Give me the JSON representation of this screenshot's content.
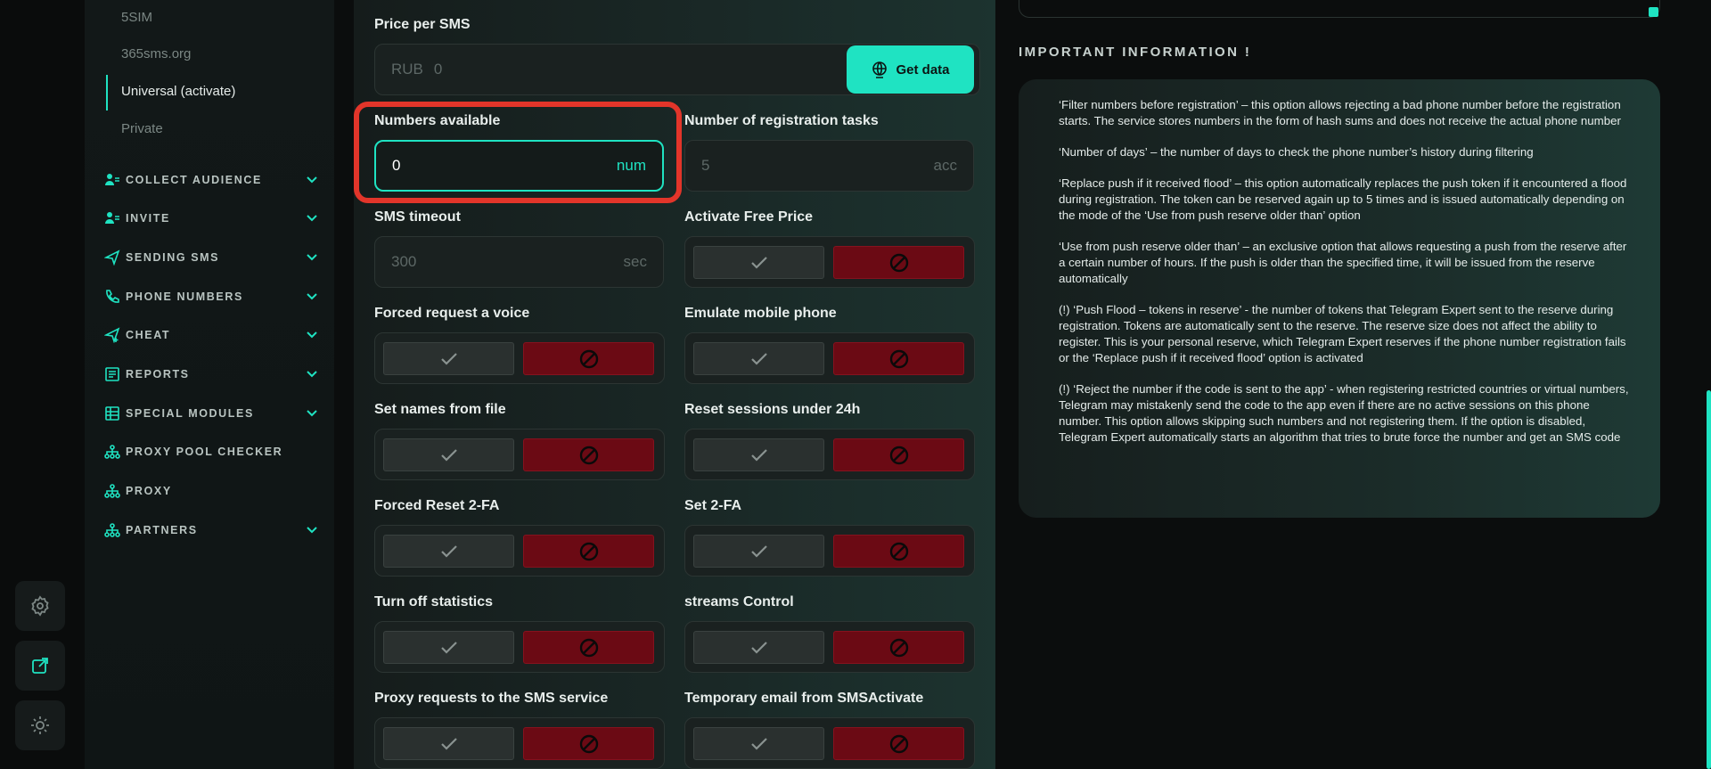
{
  "sidebar": {
    "sub_items": [
      "5SIM",
      "365sms.org",
      "Universal (activate)",
      "Private"
    ],
    "nav": [
      {
        "label": "COLLECT AUDIENCE",
        "icon": "users-icon",
        "chevron": true
      },
      {
        "label": "INVITE",
        "icon": "user-add-icon",
        "chevron": true
      },
      {
        "label": "SENDING SMS",
        "icon": "send-icon",
        "chevron": true
      },
      {
        "label": "PHONE NUMBERS",
        "icon": "phone-icon",
        "chevron": true
      },
      {
        "label": "CHEAT",
        "icon": "send-plus-icon",
        "chevron": true
      },
      {
        "label": "REPORTS",
        "icon": "report-icon",
        "chevron": true
      },
      {
        "label": "SPECIAL MODULES",
        "icon": "table-icon",
        "chevron": true
      },
      {
        "label": "PROXY POOL CHECKER",
        "icon": "network-icon",
        "chevron": false
      },
      {
        "label": "PROXY",
        "icon": "network-icon",
        "chevron": false
      },
      {
        "label": "PARTNERS",
        "icon": "network-icon",
        "chevron": true
      }
    ]
  },
  "rail": {
    "icons": [
      "settings-icon",
      "external-link-icon",
      "theme-icon"
    ]
  },
  "form": {
    "price": {
      "label": "Price per SMS",
      "currency": "RUB",
      "value": "0",
      "button": "Get data"
    },
    "numbers_available": {
      "label": "Numbers available",
      "value": "0",
      "unit": "num"
    },
    "registration_tasks": {
      "label": "Number of registration tasks",
      "value": "5",
      "unit": "acc"
    },
    "sms_timeout": {
      "label": "SMS timeout",
      "value": "300",
      "unit": "sec"
    },
    "toggles": [
      "Activate Free Price",
      "Forced request a voice",
      "Emulate mobile phone",
      "Set names from file",
      "Reset sessions under 24h",
      "Forced Reset 2-FA",
      "Set 2-FA",
      "Turn off statistics",
      "streams Control",
      "Proxy requests to the SMS service",
      "Temporary email from SMSActivate"
    ]
  },
  "info": {
    "title": "IMPORTANT INFORMATION !",
    "paragraphs": [
      "‘Filter numbers before registration’ – this option allows rejecting a bad phone number before the registration starts. The service stores numbers in the form of hash sums and does not receive the actual phone number",
      "‘Number of days’ – the number of days to check the phone number’s history during filtering",
      "‘Replace push if it received flood’ – this option automatically replaces the push token if it encountered a flood during registration. The token can be reserved again up to 5 times and is issued automatically depending on the mode of the ‘Use from push reserve older than’ option",
      "‘Use from push reserve older than’ – an exclusive option that allows requesting a push from the reserve after a certain number of hours. If the push is older than the specified time, it will be issued from the reserve automatically",
      "(!) ‘Push Flood – tokens in reserve’ - the number of tokens that Telegram Expert sent to the reserve during registration. Tokens are automatically sent to the reserve. The reserve size does not affect the ability to register. This is your personal reserve, which Telegram Expert reserves if the phone number registration fails or the ‘Replace push if it received flood’ option is activated",
      "(!) ‘Reject the number if the code is sent to the app’ - when registering restricted countries or virtual numbers, Telegram may mistakenly send the code to the app even if there are no active sessions on this phone number. This option allows skipping such numbers and not registering them. If the option is disabled, Telegram Expert automatically starts an algorithm that tries to brute force the number and get an SMS code"
    ]
  },
  "colors": {
    "accent": "#1fe3c2",
    "danger": "#6b0a14",
    "highlight": "#e2352a"
  }
}
